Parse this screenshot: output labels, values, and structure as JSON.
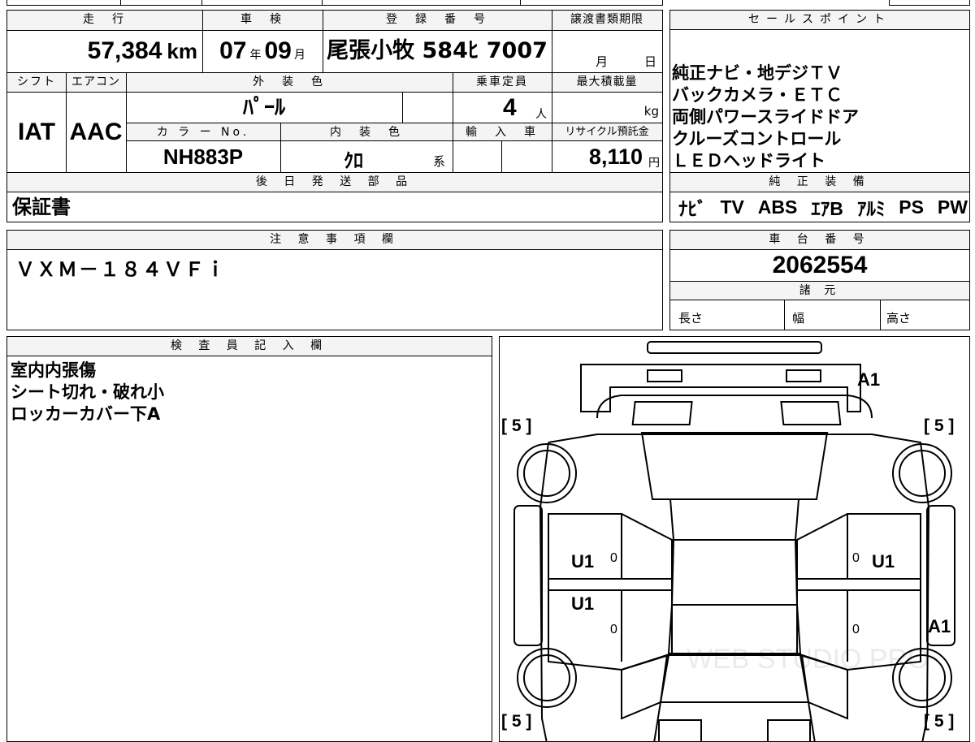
{
  "vehicle": {
    "mileage_header": "走　行",
    "mileage_value": "57,384",
    "mileage_unit": "km",
    "shaken_header": "車　検",
    "shaken_year": "07",
    "shaken_year_unit": "年",
    "shaken_month": "09",
    "shaken_month_unit": "月",
    "registration_header": "登　録　番　号",
    "registration_value": "尾張小牧 584ﾋ 7007",
    "transfer_header": "譲渡書類期限",
    "transfer_month": "月",
    "transfer_day": "日",
    "shift_header": "シフト",
    "shift_value": "IAT",
    "ac_header": "エアコン",
    "ac_value": "AAC",
    "exterior_color_header": "外　装　色",
    "exterior_color_value": "ﾊﾟｰﾙ",
    "capacity_header": "乗車定員",
    "capacity_value": "4",
    "capacity_unit": "人",
    "max_load_header": "最大積載量",
    "max_load_unit": "kg",
    "color_no_header": "カ ラ ー No.",
    "color_no_value": "NH883P",
    "interior_color_header": "内　装　色",
    "interior_color_value": "ｸﾛ",
    "interior_color_suffix": "系",
    "import_header": "輸　入　車",
    "recycle_header": "リサイクル預託金",
    "recycle_value": "8,110",
    "recycle_unit": "円"
  },
  "later_parts": {
    "header": "後 日 発 送 部 品",
    "value": "保証書"
  },
  "sales_points": {
    "header": "セールスポイント",
    "items": [
      "純正ナビ・地デジＴＶ",
      "バックカメラ・ＥＴＣ",
      "両側パワースライドドア",
      "クルーズコントロール",
      "ＬＥＤヘッドライト"
    ]
  },
  "factory_equipment": {
    "header": "純 正 装 備",
    "items": [
      "ﾅﾋﾞ",
      "TV",
      "ABS",
      "ｴｱB",
      "ｱﾙﾐ",
      "PS",
      "PW"
    ]
  },
  "notes": {
    "header": "注 意 事 項 欄",
    "value": "ＶＸＭ－１８４ＶＦｉ"
  },
  "chassis": {
    "header": "車 台 番 号",
    "value": "2062554",
    "specs_header": "諸 元",
    "length_label": "長さ",
    "width_label": "幅",
    "height_label": "高さ"
  },
  "inspector": {
    "header": "検 査 員 記 入 欄",
    "lines": [
      "室内内張傷",
      "シート切れ・破れ小",
      "ロッカーカバー下A"
    ]
  },
  "diagram": {
    "tire_front_left": "[ 5 ]",
    "tire_front_right": "[ 5 ]",
    "tire_rear_left": "[ 5 ]",
    "tire_rear_right": "[ 5 ]",
    "marks": {
      "rear_top_right": "A1",
      "left_front_door": "U1",
      "left_rear_door": "U1",
      "right_front_door": "U1",
      "rocker_right": "A1",
      "small_mark": "0"
    },
    "watermark": "WEB STUDIO PRO"
  }
}
